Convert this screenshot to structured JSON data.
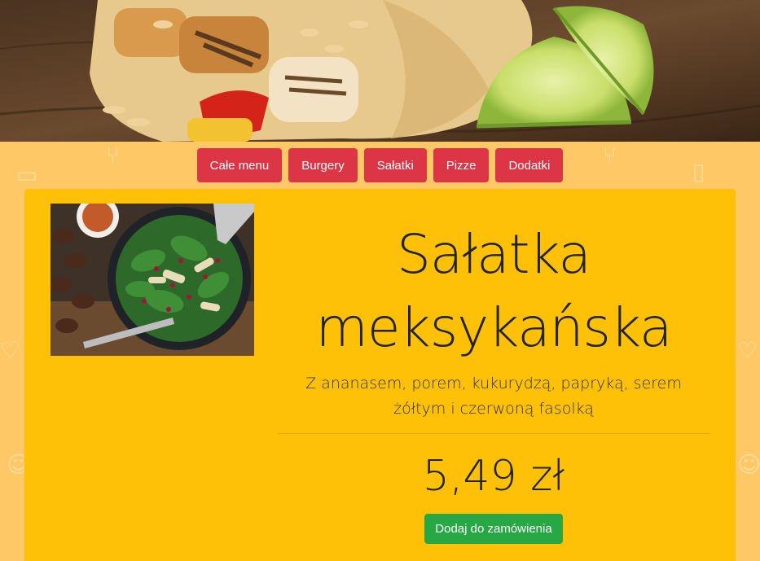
{
  "nav": {
    "items": [
      {
        "label": "Całe menu"
      },
      {
        "label": "Burgery"
      },
      {
        "label": "Sałatki"
      },
      {
        "label": "Pizze"
      },
      {
        "label": "Dodatki"
      }
    ]
  },
  "product": {
    "title_line1": "Sałatka",
    "title_line2": "meksykańska",
    "description": "Z ananasem, porem, kukurydzą, papryką, serem żółtym i czerwoną fasolką",
    "price": "5,49 zł",
    "order_label": "Dodaj do zamówienia"
  },
  "colors": {
    "background": "#ffc866",
    "card": "#ffc107",
    "nav_button": "#dc3545",
    "order_button": "#28a745"
  }
}
